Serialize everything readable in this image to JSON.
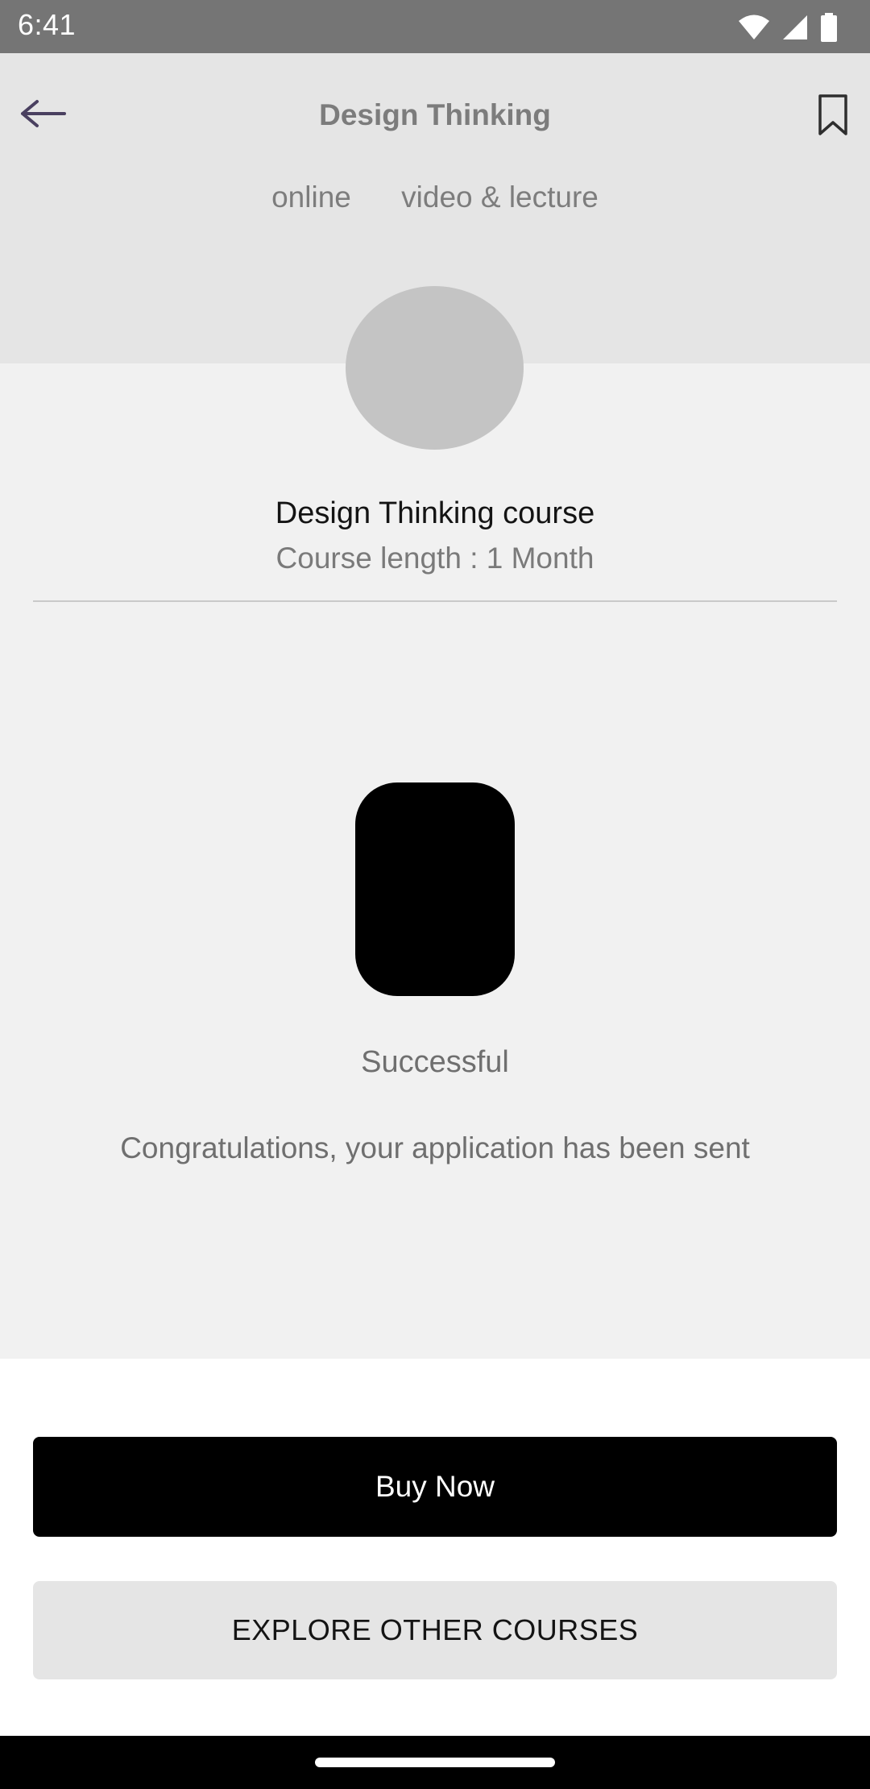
{
  "status_bar": {
    "time": "6:41",
    "icons": [
      "wifi-icon",
      "cellular-signal-icon",
      "battery-icon"
    ]
  },
  "header": {
    "title": "Design Thinking",
    "back_icon": "arrow-left-icon",
    "bookmark_icon": "bookmark-icon",
    "tags": [
      "online",
      "video & lecture"
    ]
  },
  "course": {
    "title": "Design Thinking course",
    "length": "Course length : 1 Month"
  },
  "result": {
    "title": "Successful",
    "message": "Congratulations, your application has been sent"
  },
  "actions": {
    "buy_label": "Buy Now",
    "explore_label": "EXPLORE OTHER COURSES"
  },
  "colors": {
    "header_bg": "#e5e5e5",
    "page_bg": "#f1f1f1",
    "primary_button": "#000000",
    "secondary_button": "#e5e5e5",
    "back_arrow": "#4a4060"
  }
}
